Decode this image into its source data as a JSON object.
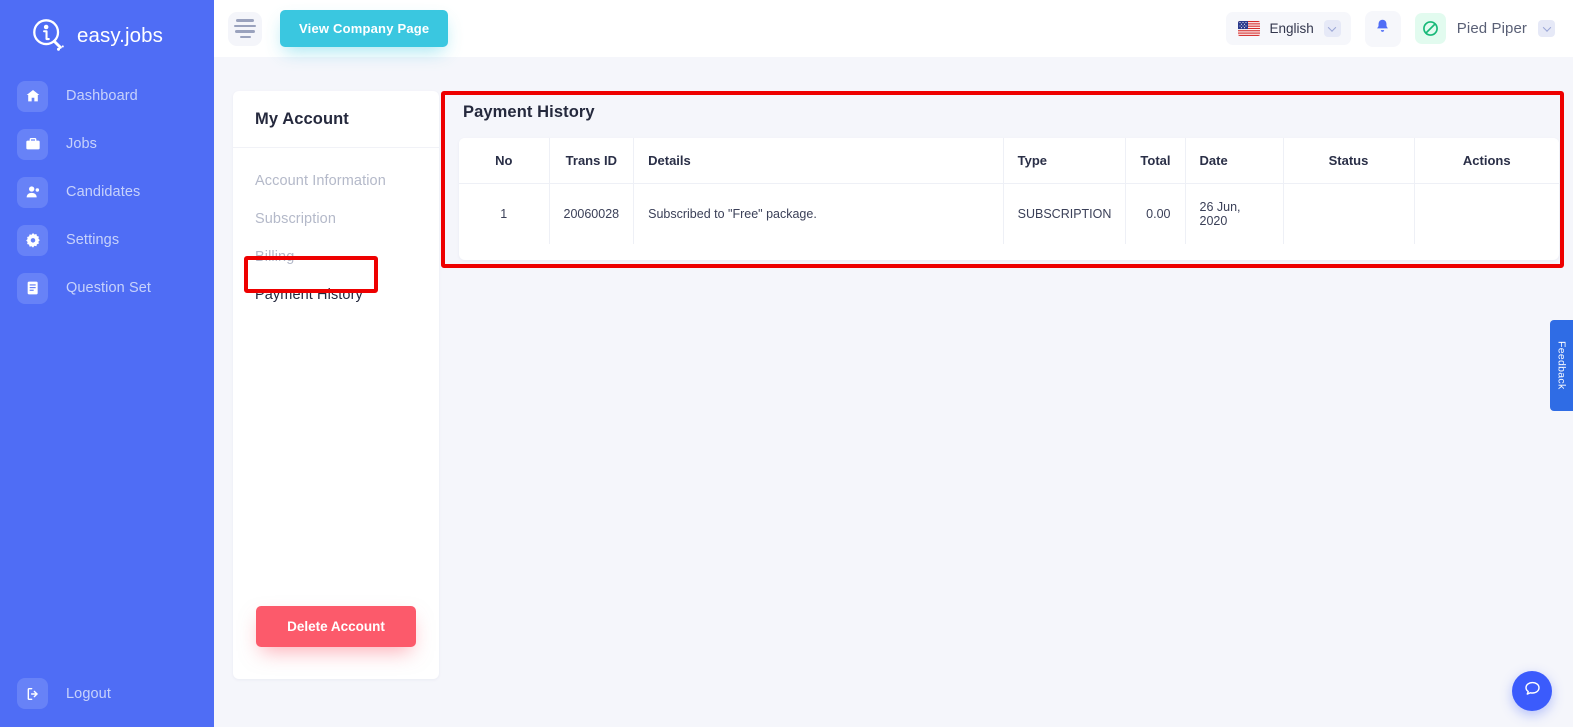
{
  "brand": {
    "name": "easy.jobs",
    "logo_icon": "magnifier-person-logo"
  },
  "sidebar": {
    "items": [
      {
        "label": "Dashboard",
        "icon": "home-icon"
      },
      {
        "label": "Jobs",
        "icon": "briefcase-icon"
      },
      {
        "label": "Candidates",
        "icon": "user-icon"
      },
      {
        "label": "Settings",
        "icon": "gear-icon"
      },
      {
        "label": "Question Set",
        "icon": "clipboard-icon"
      }
    ],
    "logout": {
      "label": "Logout",
      "icon": "logout-icon"
    },
    "bg_color": "#4f6df5"
  },
  "topbar": {
    "menu_toggle_icon": "hamburger-icon",
    "company_button": {
      "label": "View Company Page",
      "color": "#3ac7e0"
    },
    "language": {
      "value": "English",
      "flag_icon": "us-flag-icon",
      "chevron_icon": "chevron-down-icon"
    },
    "notifications_icon": "bell-icon",
    "user": {
      "name": "Pied Piper",
      "avatar_icon": "pied-piper-logo-icon",
      "chevron_icon": "chevron-down-icon"
    }
  },
  "account_card": {
    "title": "My Account",
    "links": [
      {
        "label": "Account Information",
        "active": false
      },
      {
        "label": "Subscription",
        "active": false
      },
      {
        "label": "Billing",
        "active": false
      },
      {
        "label": "Payment History",
        "active": true
      }
    ],
    "delete_button": {
      "label": "Delete Account",
      "color": "#fc5a6b"
    }
  },
  "payment_history": {
    "title": "Payment History",
    "columns": [
      "No",
      "Trans ID",
      "Details",
      "Type",
      "Total",
      "Date",
      "Status",
      "Actions"
    ],
    "rows": [
      {
        "no": "1",
        "trans_id": "20060028",
        "details": "Subscribed to \"Free\" package.",
        "type": "SUBSCRIPTION",
        "total": "0.00",
        "date": "26 Jun, 2020",
        "status": "",
        "actions": ""
      }
    ]
  },
  "widgets": {
    "feedback_tab": {
      "label": "Feedback",
      "color": "#2f6ce5"
    },
    "chat_button": {
      "icon": "chat-bubble-icon",
      "color": "#3b5bfc"
    }
  },
  "annotations": {
    "highlight_color": "#ee0000",
    "boxes": [
      "payment-history-panel",
      "payment-history-sidebar-link"
    ]
  }
}
